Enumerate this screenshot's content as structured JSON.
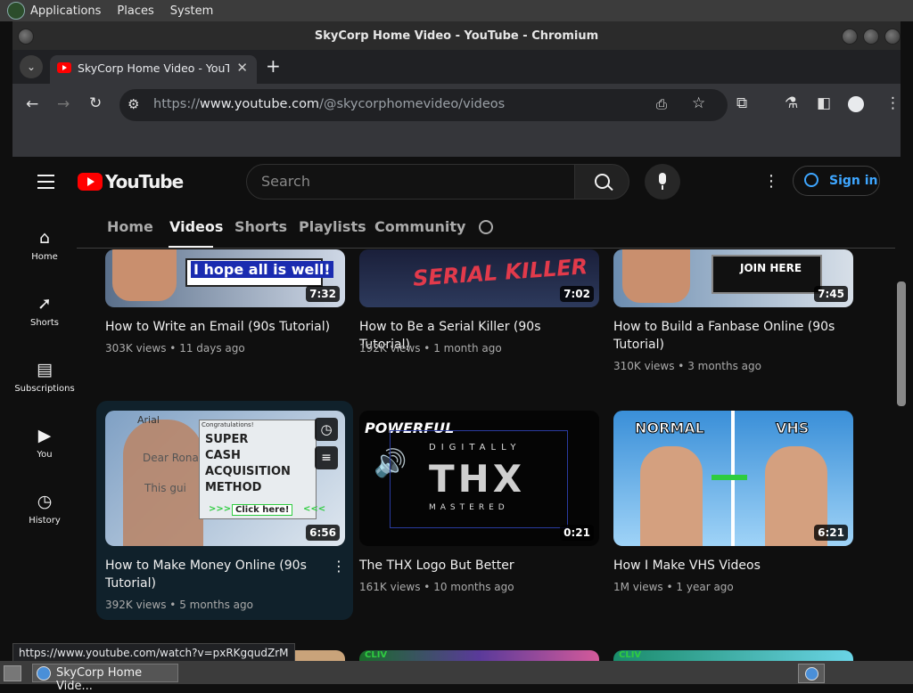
{
  "desktop": {
    "menus": [
      "Applications",
      "Places",
      "System"
    ],
    "taskbar_item": "SkyCorp Home Vide..."
  },
  "window": {
    "title": "SkyCorp Home Video - YouTube - Chromium"
  },
  "browser": {
    "tab_title": "SkyCorp Home Video - YouTube",
    "url_prefix": "https://",
    "url_host": "www.youtube.com",
    "url_path": "/@skycorphomevideo/videos",
    "status_url": "https://www.youtube.com/watch?v=pxRKgqudZrM"
  },
  "youtube": {
    "logo_text": "YouTube",
    "search_placeholder": "Search",
    "sign_in": "Sign in",
    "sidebar": [
      {
        "label": "Home",
        "icon": "home-icon"
      },
      {
        "label": "Shorts",
        "icon": "shorts-icon"
      },
      {
        "label": "Subscriptions",
        "icon": "subscriptions-icon"
      },
      {
        "label": "You",
        "icon": "you-icon"
      },
      {
        "label": "History",
        "icon": "history-icon"
      }
    ],
    "channel_tabs": [
      "Home",
      "Videos",
      "Shorts",
      "Playlists",
      "Community"
    ],
    "active_tab": "Videos",
    "videos": [
      {
        "title": "How to Write an Email (90s Tutorial)",
        "views": "303K views",
        "age": "11 days ago",
        "duration": "7:32",
        "thumb_text": "I hope all is well!"
      },
      {
        "title": "How to Be a Serial Killer (90s Tutorial)",
        "views": "192K views",
        "age": "1 month ago",
        "duration": "7:02",
        "thumb_text": "SERIAL KILLER"
      },
      {
        "title": "How to Build a Fanbase Online (90s Tutorial)",
        "views": "310K views",
        "age": "3 months ago",
        "duration": "7:45",
        "thumb_text": "JOIN HERE"
      },
      {
        "title": "How to Make Money Online (90s Tutorial)",
        "views": "392K views",
        "age": "5 months ago",
        "duration": "6:56",
        "thumb_text": [
          "SUPER",
          "CASH",
          "ACQUISITION",
          "METHOD",
          "Click here!",
          "Arial",
          "Dear Rona",
          "This gui",
          "Congratulations!",
          ">>>",
          "<<<"
        ]
      },
      {
        "title": "The THX Logo But Better",
        "views": "161K views",
        "age": "10 months ago",
        "duration": "0:21",
        "thumb_text": [
          "POWERFUL",
          "DIGITALLY",
          "THX",
          "MASTERED"
        ]
      },
      {
        "title": "How I Make VHS Videos",
        "views": "1M views",
        "age": "1 year ago",
        "duration": "6:21",
        "thumb_text": [
          "NORMAL",
          "VHS"
        ]
      }
    ],
    "bottom_row_labels": [
      "CLIV",
      "CLIV"
    ]
  }
}
